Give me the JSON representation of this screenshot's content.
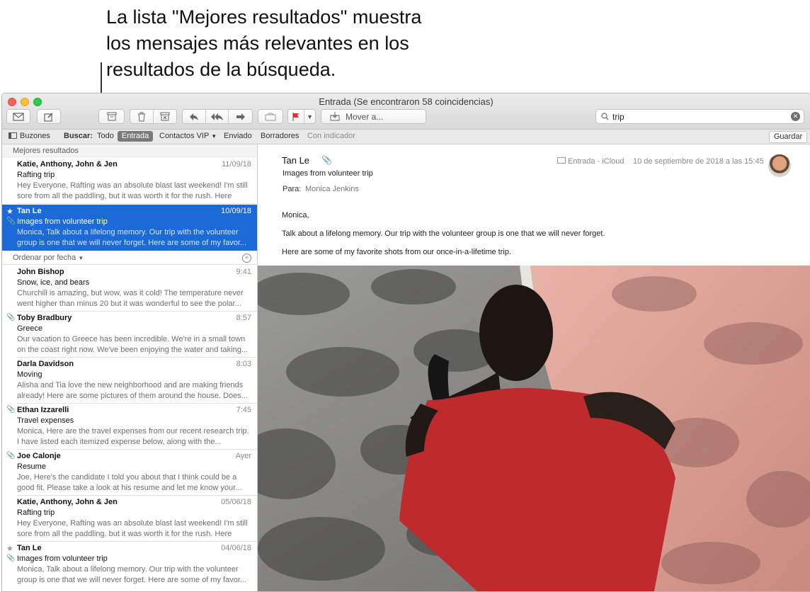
{
  "callout": {
    "line1": "La lista \"Mejores resultados\" muestra",
    "line2": "los mensajes más relevantes en los",
    "line3": "resultados de la búsqueda."
  },
  "window": {
    "title": "Entrada (Se encontraron 58 coincidencias)"
  },
  "toolbar": {
    "move_label": "Mover a...",
    "search_value": "trip"
  },
  "scope": {
    "mailboxes": "Buzones",
    "search_label": "Buscar:",
    "items": [
      "Todo",
      "Entrada",
      "Contactos VIP",
      "Enviado",
      "Borradores",
      "Con indicador"
    ],
    "selected": "Entrada",
    "save": "Guardar"
  },
  "top_hits": {
    "header": "Mejores resultados",
    "messages": [
      {
        "from": "Katie, Anthony, John & Jen",
        "date": "11/09/18",
        "subject": "Rafting trip",
        "preview": "Hey Everyone, Rafting was an absolute blast last weekend! I'm still sore from all the paddling, but it was worth it for the rush. Here are..."
      },
      {
        "from": "Tan Le",
        "date": "10/09/18",
        "subject": "Images from volunteer trip",
        "preview": "Monica, Talk about a lifelong memory. Our trip with the volunteer group is one that we will never forget.  Here are some of my favor..."
      }
    ]
  },
  "sort": {
    "label": "Ordenar por fecha"
  },
  "messages": [
    {
      "from": "John Bishop",
      "date": "9:41",
      "subject": "Snow, ice, and bears",
      "preview": "Churchill is amazing, but wow, was it cold! The temperature never went higher than minus 20 but it was wonderful to see the polar..."
    },
    {
      "from": "Toby Bradbury",
      "date": "8:57",
      "subject": "Greece",
      "preview": "Our vacation to Greece has been incredible. We're in a small town on the coast right now. We've been enjoying the water and taking..."
    },
    {
      "from": "Darla Davidson",
      "date": "8:03",
      "subject": "Moving",
      "preview": "Alisha and Tia love the new neighborhood and are making friends already! Here are some pictures of them around the house. Does..."
    },
    {
      "from": "Ethan Izzarelli",
      "date": "7:45",
      "subject": "Travel expenses",
      "preview": "Monica, Here are the travel expenses from our recent research trip. I have listed each itemized expense below, along with the..."
    },
    {
      "from": "Joe Calonje",
      "date": "Ayer",
      "subject": "Resume",
      "preview": "Joe, Here's the candidate I told you about that I think could be a good fit. Please take a look at his resume and let me know your..."
    },
    {
      "from": "Katie, Anthony, John & Jen",
      "date": "05/06/18",
      "subject": "Rafting trip",
      "preview": "Hey Everyone, Rafting was an absolute blast last weekend! I'm still sore from all the paddling, but it was worth it for the rush. Here are..."
    },
    {
      "from": "Tan Le",
      "date": "04/06/18",
      "subject": "Images from volunteer trip",
      "preview": "Monica, Talk about a lifelong memory. Our trip with the volunteer group is one that we will never forget.  Here are some of my favor..."
    }
  ],
  "reader": {
    "from": "Tan Le",
    "subject": "Images from volunteer trip",
    "to_label": "Para:",
    "to": "Monica Jenkins",
    "mailbox": "Entrada - iCloud",
    "date": "10 de septiembre de 2018 a las 15:45",
    "greeting": "Monica,",
    "p1": "Talk about a lifelong memory. Our trip with the volunteer group is one that we will never forget.",
    "p2": "Here are some of my favorite shots from our once-in-a-lifetime trip."
  },
  "colors": {
    "selection": "#1b6ad8",
    "flag": "#e0322c",
    "shirt": "#c0262c",
    "court": "#e3a49a"
  }
}
